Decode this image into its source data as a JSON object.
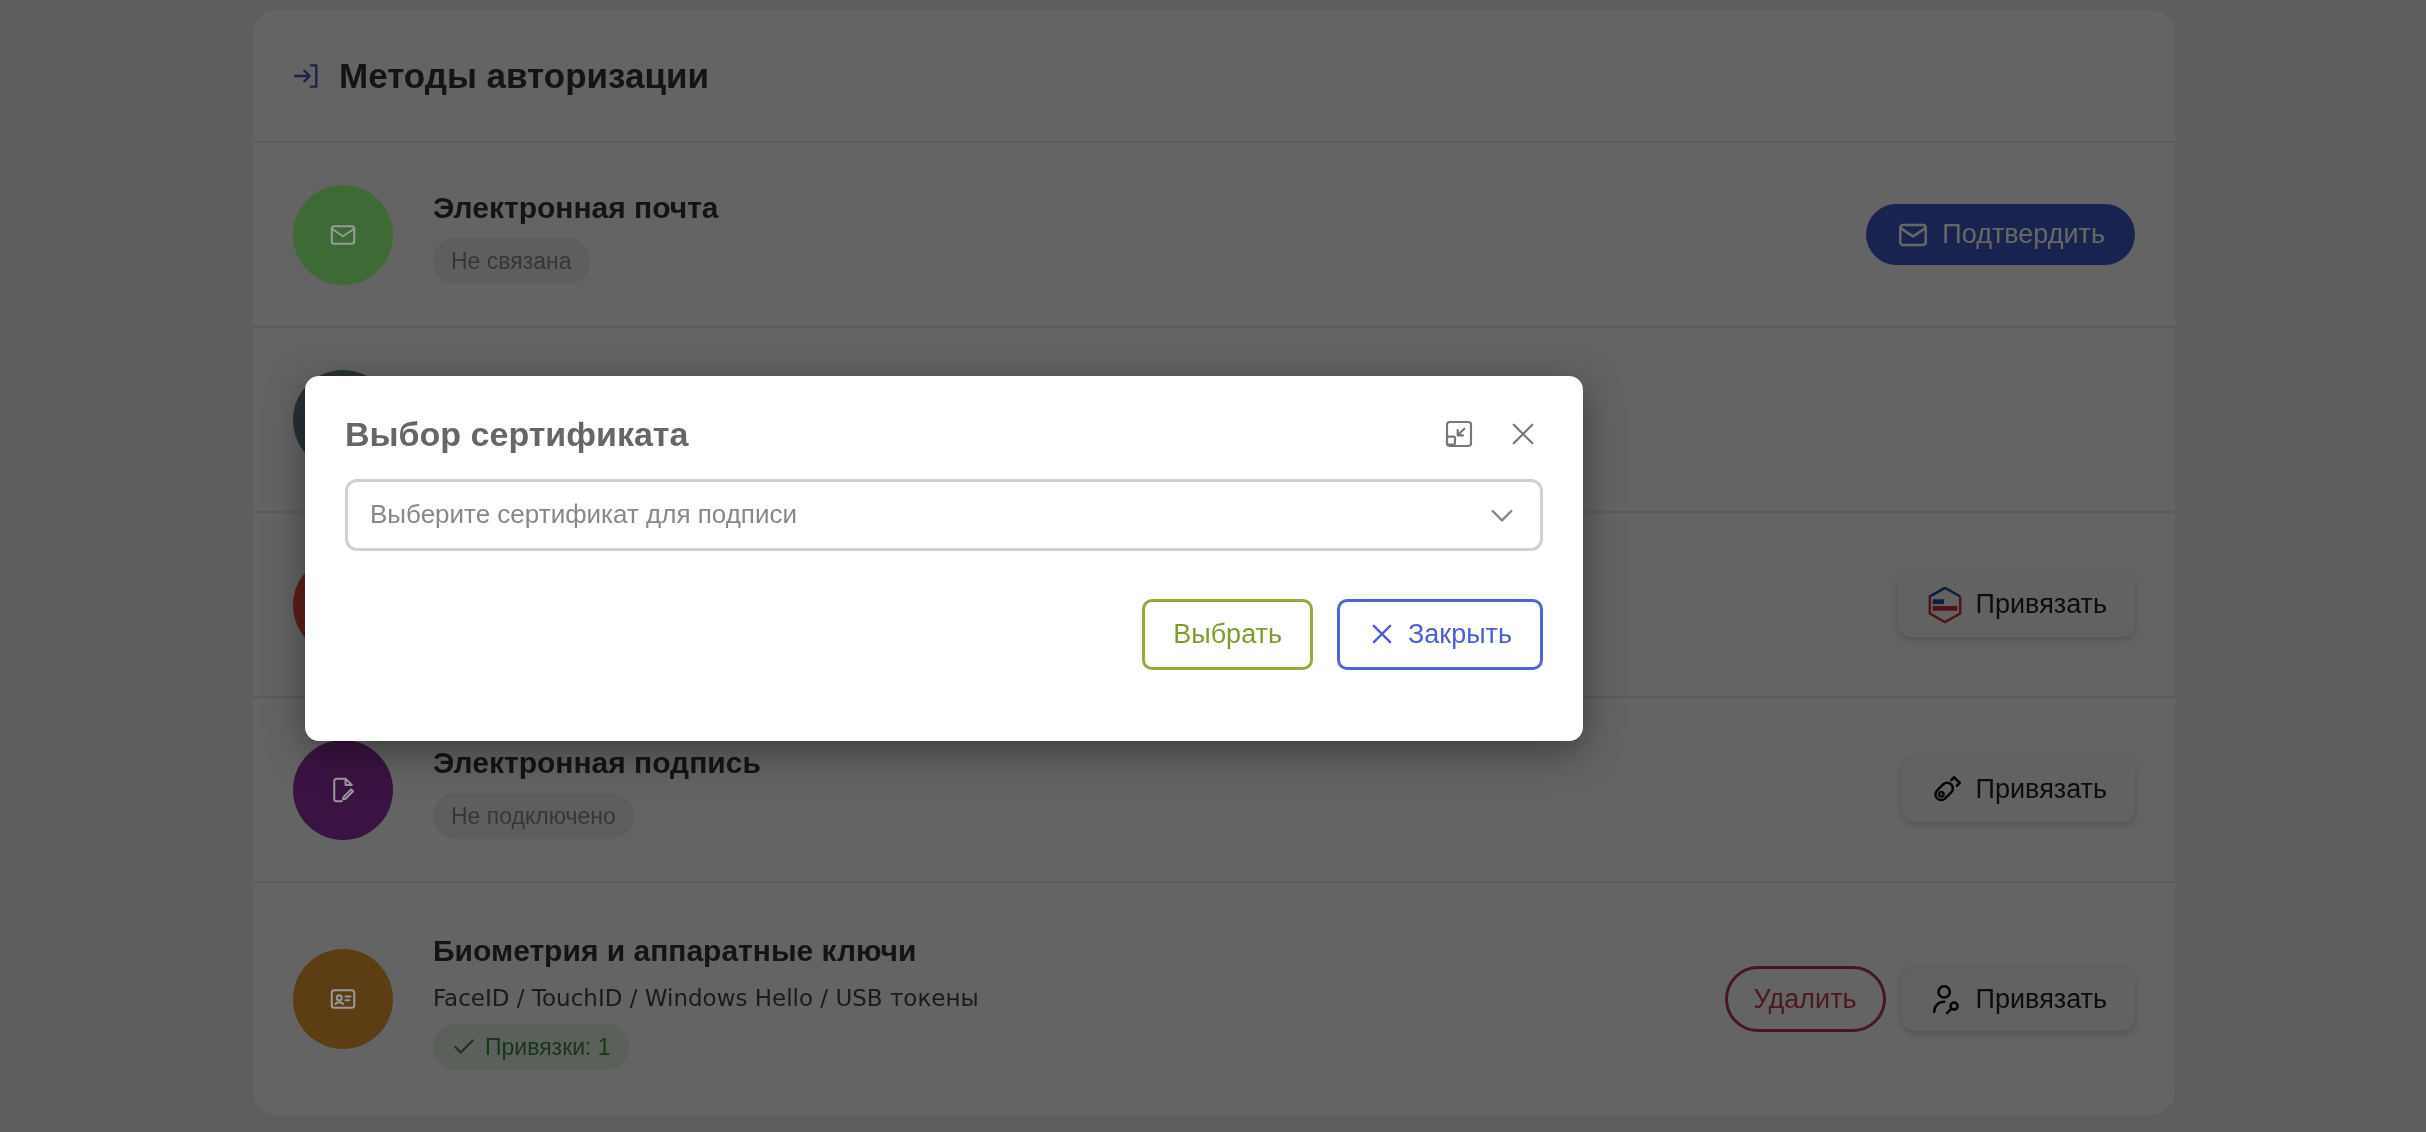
{
  "card": {
    "title": "Методы авторизации"
  },
  "methods": [
    {
      "color": "#3e6b35",
      "title": "Электронная почта",
      "badge": {
        "text": "Не связана",
        "kind": "neutral"
      },
      "buttons": [
        {
          "label": "Подтвердить",
          "kind": "primary"
        }
      ]
    },
    {
      "color": "#283236"
    },
    {
      "color": "#5e1f1a",
      "buttons": [
        {
          "label": "Привязать",
          "kind": "light"
        }
      ]
    },
    {
      "color": "#3a1342",
      "title": "Электронная подпись",
      "badge": {
        "text": "Не подключено",
        "kind": "neutral"
      },
      "buttons": [
        {
          "label": "Привязать",
          "kind": "light"
        }
      ]
    },
    {
      "color": "#5d3d14",
      "title": "Биометрия и аппаратные ключи",
      "subtitle": "FaceID / TouchID / Windows Hello / USB токены",
      "badge": {
        "text": "Привязки: 1",
        "kind": "success"
      },
      "buttons": [
        {
          "label": "Удалить",
          "kind": "danger"
        },
        {
          "label": "Привязать",
          "kind": "light"
        }
      ]
    }
  ],
  "modal": {
    "title": "Выбор сертификата",
    "select": {
      "placeholder": "Выберите сертификат для подписи"
    },
    "buttons": [
      {
        "label": "Выбрать",
        "kind": "confirm"
      },
      {
        "label": "Закрыть",
        "kind": "close"
      }
    ]
  }
}
